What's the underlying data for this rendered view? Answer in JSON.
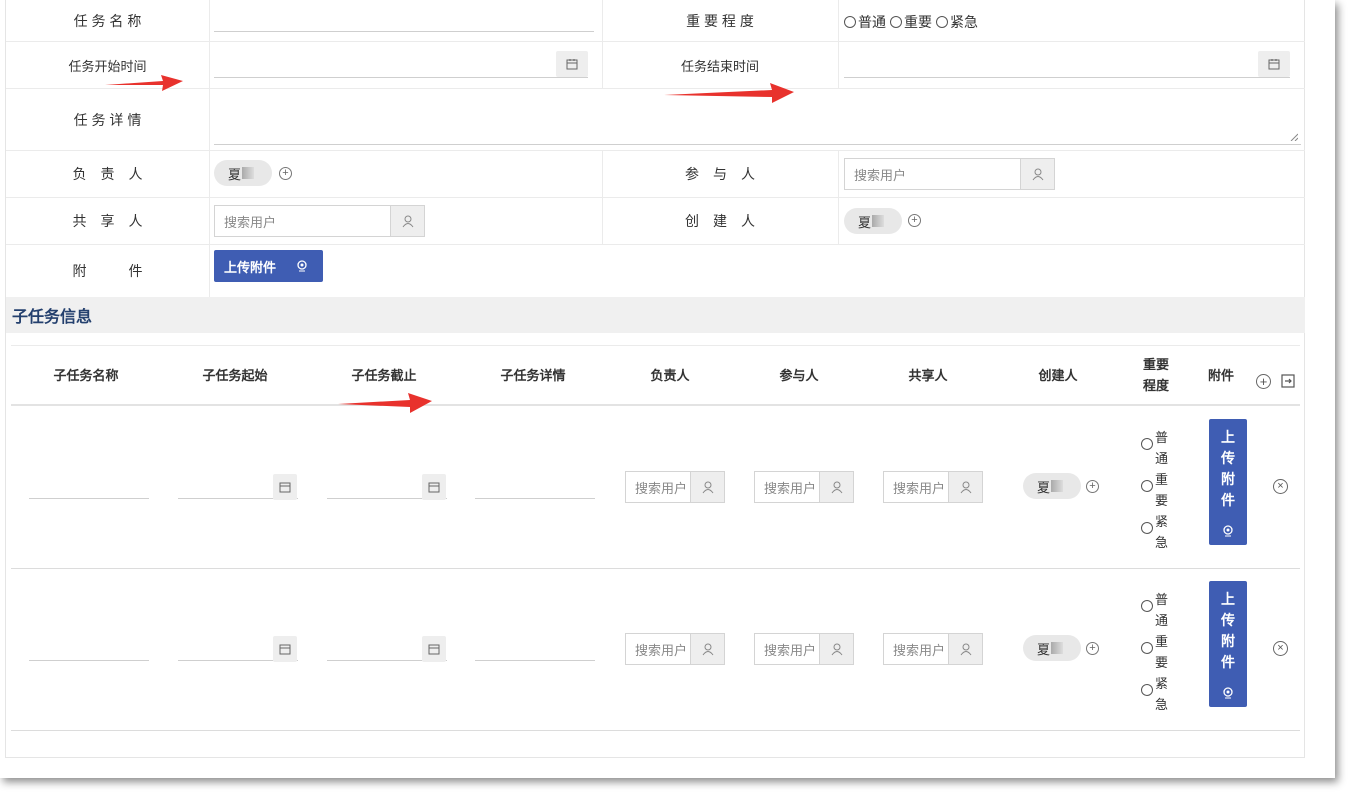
{
  "form": {
    "task_name_label": "任 务 名 称",
    "importance_label": "重 要 程 度",
    "importance_options": [
      "普通",
      "重要",
      "紧急"
    ],
    "start_time_label": "任务开始时间",
    "end_time_label": "任务结束时间",
    "details_label": "任 务 详 情",
    "owner_label": "负　责　人",
    "owner_value": "夏",
    "participants_label": "参　与　人",
    "participants_placeholder": "搜索用户",
    "sharers_label": "共　享　人",
    "sharers_placeholder": "搜索用户",
    "creator_label": "创　建　人",
    "creator_value": "夏",
    "attachment_label": "附　　　件",
    "upload_label": "上传附件"
  },
  "subtasks": {
    "section_title": "子任务信息",
    "columns": [
      "子任务名称",
      "子任务起始",
      "子任务截止",
      "子任务详情",
      "负责人",
      "参与人",
      "共享人",
      "创建人",
      "重要程度",
      "附件"
    ],
    "importance_col_line1": "重要",
    "importance_col_line2": "程度",
    "rows": [
      {
        "owner_placeholder": "搜索用户",
        "participants_placeholder": "搜索用户",
        "sharers_placeholder": "搜索用户",
        "creator": "夏",
        "importance_options": [
          "普通",
          "重要",
          "紧急"
        ],
        "upload_label": "上传附件"
      },
      {
        "owner_placeholder": "搜索用户",
        "participants_placeholder": "搜索用户",
        "sharers_placeholder": "搜索用户",
        "creator": "夏",
        "importance_options": [
          "普通",
          "重要",
          "紧急"
        ],
        "upload_label": "上传附件"
      }
    ]
  },
  "colors": {
    "accent": "#3f5db3",
    "section_title": "#24406e",
    "annotation_arrow": "#e8322d"
  }
}
